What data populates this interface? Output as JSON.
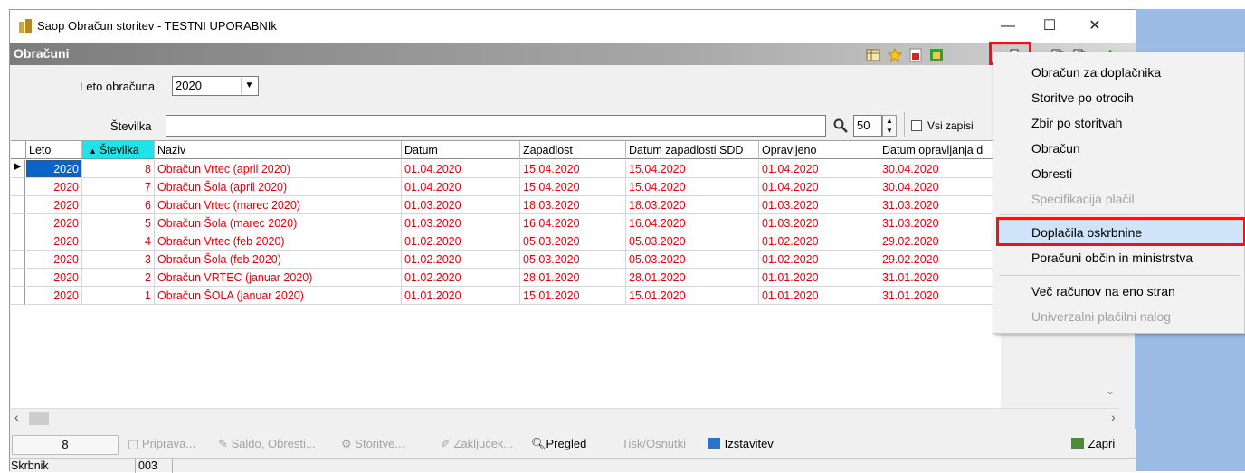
{
  "window": {
    "title": "Saop Obračun storitev - TESTNI UPORABNIk"
  },
  "header": {
    "label": "Obračuni"
  },
  "filters": {
    "year_label": "Leto obračuna",
    "year_value": "2020",
    "number_label": "Številka",
    "number_value": "",
    "page_size": "50",
    "all_records_label": "Vsi zapisi"
  },
  "grid": {
    "columns": [
      "Leto",
      "Številka",
      "Naziv",
      "Datum",
      "Zapadlost",
      "Datum zapadlosti SDD",
      "Opravljeno",
      "Datum opravljanja d"
    ],
    "sort_indicator": "▲",
    "rows": [
      [
        "2020",
        "8",
        "Obračun Vrtec (april 2020)",
        "01.04.2020",
        "15.04.2020",
        "15.04.2020",
        "01.04.2020",
        "30.04.2020"
      ],
      [
        "2020",
        "7",
        "Obračun Šola (april 2020)",
        "01.04.2020",
        "15.04.2020",
        "15.04.2020",
        "01.04.2020",
        "30.04.2020"
      ],
      [
        "2020",
        "6",
        "Obračun Vrtec (marec 2020)",
        "01.03.2020",
        "18.03.2020",
        "18.03.2020",
        "01.03.2020",
        "31.03.2020"
      ],
      [
        "2020",
        "5",
        "Obračun Šola (marec 2020)",
        "01.03.2020",
        "16.04.2020",
        "16.04.2020",
        "01.03.2020",
        "31.03.2020"
      ],
      [
        "2020",
        "4",
        "Obračun Vrtec (feb 2020)",
        "01.02.2020",
        "05.03.2020",
        "05.03.2020",
        "01.02.2020",
        "29.02.2020"
      ],
      [
        "2020",
        "3",
        "Obračun Šola (feb 2020)",
        "01.02.2020",
        "05.03.2020",
        "05.03.2020",
        "01.02.2020",
        "29.02.2020"
      ],
      [
        "2020",
        "2",
        "Obračun VRTEC (januar 2020)",
        "01.02.2020",
        "28.01.2020",
        "28.01.2020",
        "01.01.2020",
        "31.01.2020"
      ],
      [
        "2020",
        "1",
        "Obračun ŠOLA (januar 2020)",
        "01.01.2020",
        "15.01.2020",
        "15.01.2020",
        "01.01.2020",
        "31.01.2020"
      ]
    ],
    "row_color": "#e8000b"
  },
  "bottom": {
    "count": "8",
    "buttons": [
      "Priprava...",
      "Saldo, Obresti...",
      "Storitve...",
      "Zaključek...",
      "Pregled",
      "Tisk/Osnutki",
      "Izstavitev",
      "Zapri"
    ]
  },
  "status": {
    "label": "Skrbnik",
    "value": "003"
  },
  "menu": {
    "items": [
      "Obračun za doplačnika",
      "Storitve po otrocih",
      "Zbir po storitvah",
      "Obračun",
      "Obresti",
      "Specifikacija plačil",
      "Doplačila oskrbnine",
      "Poračuni občin in ministrstva",
      "Več računov na eno stran",
      "Univerzalni plačilni nalog"
    ]
  },
  "colors": {
    "accent_highlight": "#e8141e",
    "selection": "#0a63c9"
  }
}
